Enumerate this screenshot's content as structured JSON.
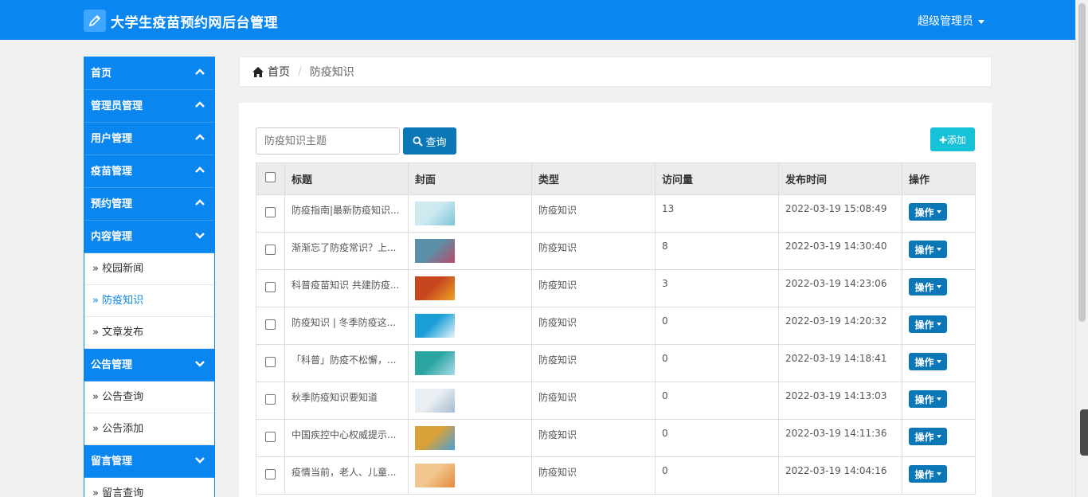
{
  "header": {
    "brand": "大学生疫苗预约网后台管理",
    "user": "超级管理员",
    "logo_icon": "pencil-icon",
    "colors": {
      "primary": "#0a86f0",
      "button": "#0b77b6",
      "add": "#17c1d8"
    }
  },
  "sidebar": {
    "groups": [
      {
        "label": "首页",
        "expanded": false,
        "items": []
      },
      {
        "label": "管理员管理",
        "expanded": false,
        "items": []
      },
      {
        "label": "用户管理",
        "expanded": false,
        "items": []
      },
      {
        "label": "疫苗管理",
        "expanded": false,
        "items": []
      },
      {
        "label": "预约管理",
        "expanded": false,
        "items": []
      },
      {
        "label": "内容管理",
        "expanded": true,
        "items": [
          "» 校园新闻",
          "» 防疫知识",
          "» 文章发布"
        ]
      },
      {
        "label": "公告管理",
        "expanded": true,
        "items": [
          "» 公告查询",
          "» 公告添加"
        ]
      },
      {
        "label": "留言管理",
        "expanded": true,
        "items": [
          "» 留言查询"
        ]
      }
    ]
  },
  "breadcrumb": {
    "home": "首页",
    "current": "防疫知识"
  },
  "toolbar": {
    "search_placeholder": "防疫知识主题",
    "search_label": "查询",
    "add_label": "添加"
  },
  "table": {
    "headers": [
      "标题",
      "封面",
      "类型",
      "访问量",
      "发布时间",
      "操作"
    ],
    "op_label": "操作",
    "rows": [
      {
        "title": "防疫指南|最新防疫知识...",
        "type": "防疫知识",
        "views": "13",
        "time": "2022-03-19 15:08:49",
        "cover": [
          "#cfe9f0",
          "#7cc4d8"
        ]
      },
      {
        "title": "渐渐忘了防疫常识？上...",
        "type": "防疫知识",
        "views": "8",
        "time": "2022-03-19 14:30:40",
        "cover": [
          "#5a8fa8",
          "#b84c6a"
        ]
      },
      {
        "title": "科普疫苗知识 共建防疫...",
        "type": "防疫知识",
        "views": "3",
        "time": "2022-03-19 14:23:06",
        "cover": [
          "#c6461f",
          "#f0a324"
        ]
      },
      {
        "title": "防疫知识 | 冬季防疫这...",
        "type": "防疫知识",
        "views": "0",
        "time": "2022-03-19 14:20:32",
        "cover": [
          "#1c9fd6",
          "#e8f4fa"
        ]
      },
      {
        "title": "「科普」防疫不松懈，...",
        "type": "防疫知识",
        "views": "0",
        "time": "2022-03-19 14:18:41",
        "cover": [
          "#2aa5a0",
          "#a9dceb"
        ]
      },
      {
        "title": "秋季防疫知识要知道",
        "type": "防疫知识",
        "views": "0",
        "time": "2022-03-19 14:13:03",
        "cover": [
          "#e9eef3",
          "#a6bccf"
        ]
      },
      {
        "title": "中国疾控中心权威提示...",
        "type": "防疫知识",
        "views": "0",
        "time": "2022-03-19 14:11:36",
        "cover": [
          "#d9a13a",
          "#4a9fd8"
        ]
      },
      {
        "title": "疫情当前，老人、儿童...",
        "type": "防疫知识",
        "views": "0",
        "time": "2022-03-19 14:04:16",
        "cover": [
          "#f1c68e",
          "#e58a3a"
        ]
      }
    ]
  }
}
